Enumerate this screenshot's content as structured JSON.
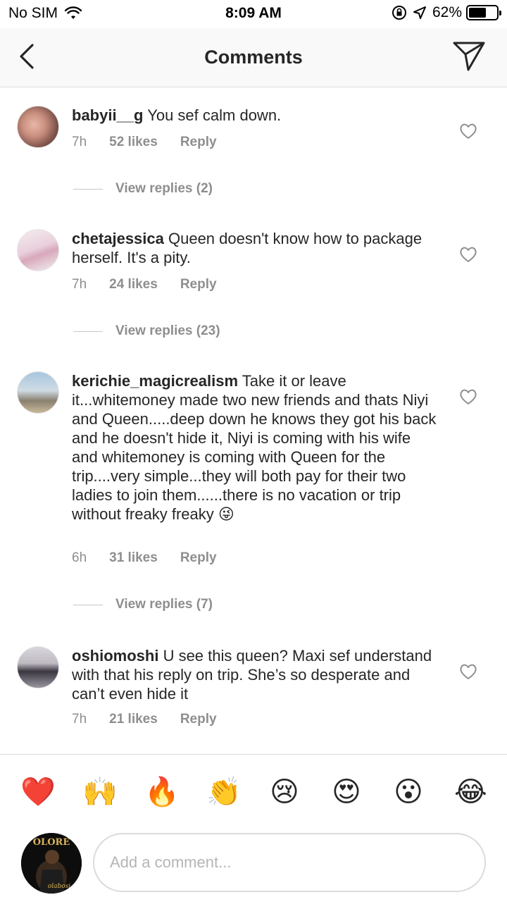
{
  "status_bar": {
    "carrier": "No SIM",
    "time": "8:09 AM",
    "battery": "62%",
    "battery_level": 0.62
  },
  "nav": {
    "title": "Comments"
  },
  "comments": [
    {
      "username": "babyii__g",
      "text": " You sef calm down.",
      "age": "7h",
      "likes": "52 likes",
      "reply": "Reply",
      "view_replies": "View replies (2)"
    },
    {
      "username": "chetajessica",
      "text": " Queen doesn't know how to package herself. It's a pity.",
      "age": "7h",
      "likes": "24 likes",
      "reply": "Reply",
      "view_replies": "View replies (23)"
    },
    {
      "username": "kerichie_magicrealism",
      "text": " Take it or leave it...whitemoney made two new friends and thats Niyi and Queen.....deep down he knows they got his back and he doesn't hide it, Niyi is coming with his wife and whitemoney is coming with Queen for the trip....very simple...they will both pay for their two ladies to join them......there is no vacation or trip without freaky freaky 😜",
      "age": "6h",
      "likes": "31 likes",
      "reply": "Reply",
      "view_replies": "View replies (7)"
    },
    {
      "username": "oshiomoshi",
      "text": " U see this queen? Maxi sef understand with that his reply on trip. She’s so desperate and can’t even hide it",
      "age": "7h",
      "likes": "21 likes",
      "reply": "Reply"
    }
  ],
  "emoji_bar": [
    "❤️",
    "🙌",
    "🔥",
    "👏",
    "😢",
    "😍",
    "😮",
    "😂"
  ],
  "compose": {
    "placeholder": "Add a comment...",
    "avatar_text": "OLORE",
    "avatar_sub": "olabosi"
  }
}
